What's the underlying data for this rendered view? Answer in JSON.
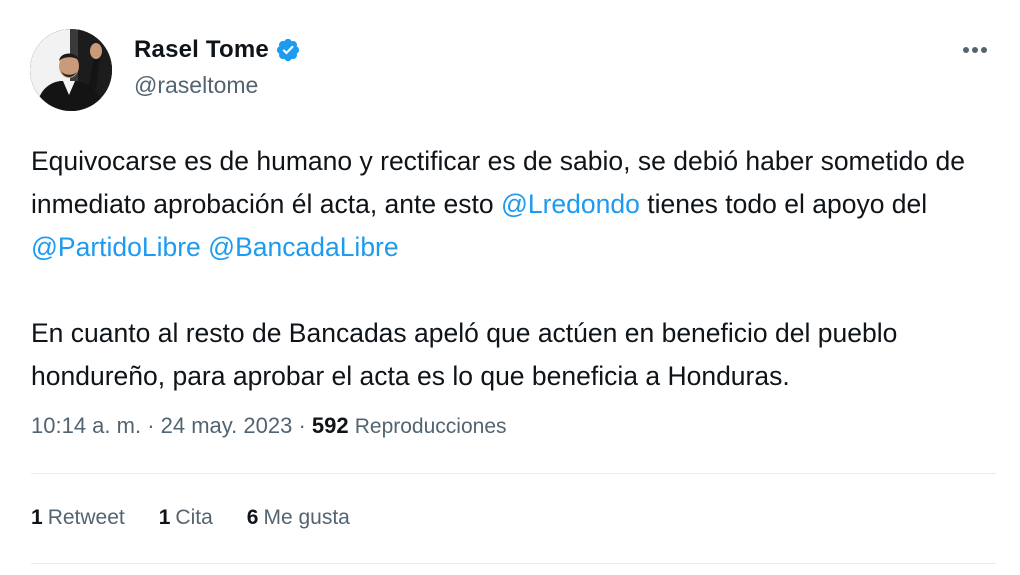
{
  "author": {
    "name": "Rasel Tome",
    "handle": "@raseltome",
    "verified": true
  },
  "tweet": {
    "paragraph1": {
      "t1": "Equivocarse es de humano y rectificar es de sabio, se debió haber sometido de inmediato aprobación él acta, ante esto ",
      "m1": "@Lredondo",
      "t2": " tienes todo el apoyo del ",
      "m2": "@PartidoLibre",
      "t3": " ",
      "m3": "@BancadaLibre"
    },
    "paragraph2": "En cuanto al resto de Bancadas apeló que actúen en beneficio del pueblo hondureño, para aprobar el acta es lo que beneficia a Honduras."
  },
  "meta": {
    "time": "10:14 a. m.",
    "separator": " · ",
    "date": "24 may. 2023",
    "views_count": "592",
    "views_label": "Reproducciones"
  },
  "stats": {
    "retweets_count": "1",
    "retweets_label": "Retweet",
    "quotes_count": "1",
    "quotes_label": "Cita",
    "likes_count": "6",
    "likes_label": "Me gusta"
  },
  "colors": {
    "accent": "#1d9bf0",
    "text": "#0f1419",
    "secondary": "#536471",
    "divider": "#e6ecf0"
  },
  "icons": {
    "verified": "verified-badge-icon",
    "more": "more-options-icon"
  }
}
